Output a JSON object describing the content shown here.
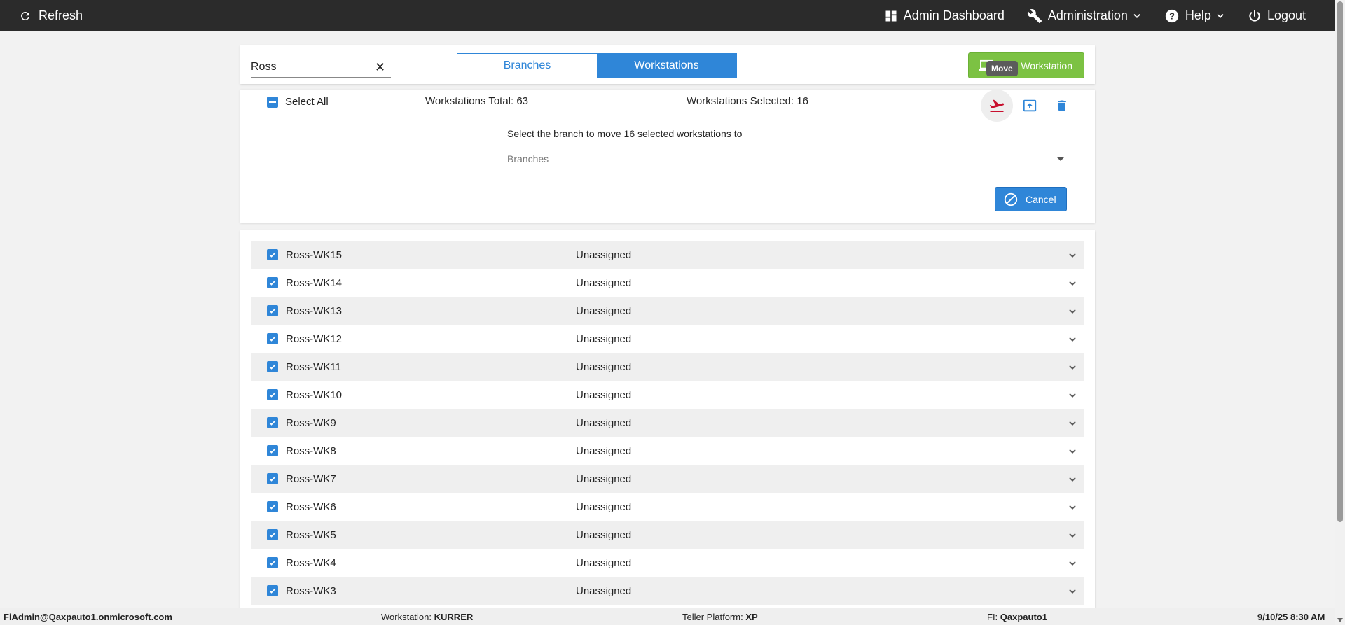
{
  "topbar": {
    "refresh_label": "Refresh",
    "admin_dashboard_label": "Admin Dashboard",
    "administration_label": "Administration",
    "help_label": "Help",
    "logout_label": "Logout"
  },
  "search": {
    "value": "Ross",
    "clear_glyph": "✕"
  },
  "view_toggle": {
    "branches_label": "Branches",
    "workstations_label": "Workstations",
    "active": "Workstations"
  },
  "add_button": {
    "label": "Workstation"
  },
  "tooltip": {
    "text": "Move"
  },
  "actions": {
    "select_all_label": "Select All",
    "total_label": "Workstations Total: 63",
    "selected_label": "Workstations Selected: 16",
    "move_prompt": "Select the branch to move 16 selected workstations to",
    "branches_placeholder": "Branches",
    "cancel_label": "Cancel"
  },
  "workstations": [
    {
      "name": "Ross-WK15",
      "status": "Unassigned"
    },
    {
      "name": "Ross-WK14",
      "status": "Unassigned"
    },
    {
      "name": "Ross-WK13",
      "status": "Unassigned"
    },
    {
      "name": "Ross-WK12",
      "status": "Unassigned"
    },
    {
      "name": "Ross-WK11",
      "status": "Unassigned"
    },
    {
      "name": "Ross-WK10",
      "status": "Unassigned"
    },
    {
      "name": "Ross-WK9",
      "status": "Unassigned"
    },
    {
      "name": "Ross-WK8",
      "status": "Unassigned"
    },
    {
      "name": "Ross-WK7",
      "status": "Unassigned"
    },
    {
      "name": "Ross-WK6",
      "status": "Unassigned"
    },
    {
      "name": "Ross-WK5",
      "status": "Unassigned"
    },
    {
      "name": "Ross-WK4",
      "status": "Unassigned"
    },
    {
      "name": "Ross-WK3",
      "status": "Unassigned"
    }
  ],
  "footer": {
    "user": "FiAdmin@Qaxpauto1.onmicrosoft.com",
    "workstation_label": "Workstation:",
    "workstation_value": "KURRER",
    "platform_label": "Teller Platform:",
    "platform_value": "XP",
    "fi_label": "FI:",
    "fi_value": "Qaxpauto1",
    "datetime": "9/10/25 8:30 AM"
  },
  "colors": {
    "accent": "#2f86d8",
    "add_green": "#7cc243",
    "move_red": "#c8102e",
    "topbar": "#2b2b2b"
  }
}
